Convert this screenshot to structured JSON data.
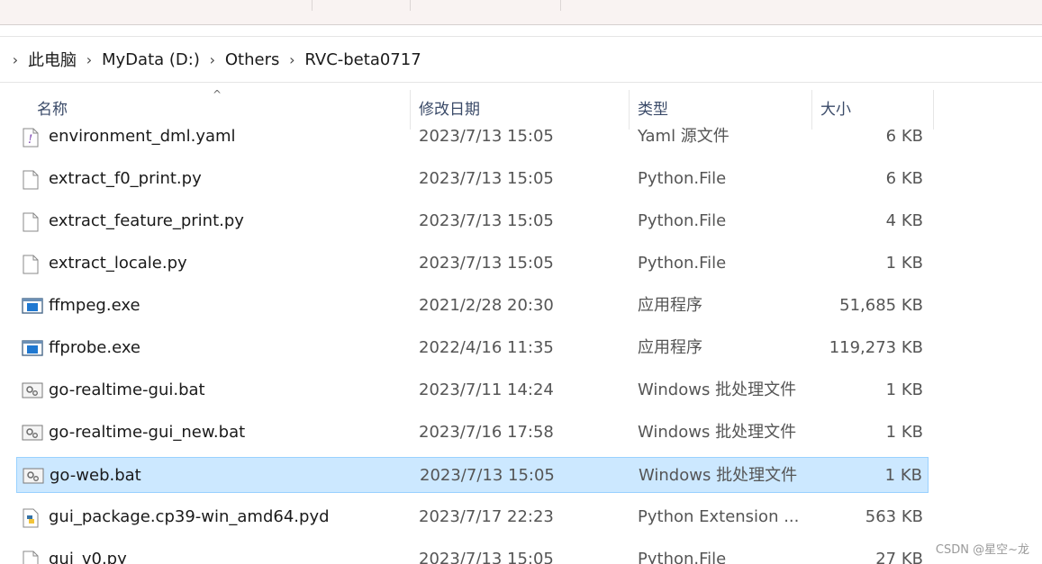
{
  "breadcrumb": [
    "此电脑",
    "MyData (D:)",
    "Others",
    "RVC-beta0717"
  ],
  "columns": {
    "name": "名称",
    "date": "修改日期",
    "type": "类型",
    "size": "大小"
  },
  "files": [
    {
      "name": "environment_dml.yaml",
      "date": "2023/7/13 15:05",
      "type": "Yaml 源文件",
      "size": "6 KB",
      "icon": "yaml-file-icon"
    },
    {
      "name": "extract_f0_print.py",
      "date": "2023/7/13 15:05",
      "type": "Python.File",
      "size": "6 KB",
      "icon": "blank-file-icon"
    },
    {
      "name": "extract_feature_print.py",
      "date": "2023/7/13 15:05",
      "type": "Python.File",
      "size": "4 KB",
      "icon": "blank-file-icon"
    },
    {
      "name": "extract_locale.py",
      "date": "2023/7/13 15:05",
      "type": "Python.File",
      "size": "1 KB",
      "icon": "blank-file-icon"
    },
    {
      "name": "ffmpeg.exe",
      "date": "2021/2/28 20:30",
      "type": "应用程序",
      "size": "51,685 KB",
      "icon": "exe-icon"
    },
    {
      "name": "ffprobe.exe",
      "date": "2022/4/16 11:35",
      "type": "应用程序",
      "size": "119,273 KB",
      "icon": "exe-icon"
    },
    {
      "name": "go-realtime-gui.bat",
      "date": "2023/7/11 14:24",
      "type": "Windows 批处理文件",
      "size": "1 KB",
      "icon": "batch-file-icon"
    },
    {
      "name": "go-realtime-gui_new.bat",
      "date": "2023/7/16 17:58",
      "type": "Windows 批处理文件",
      "size": "1 KB",
      "icon": "batch-file-icon"
    },
    {
      "name": "go-web.bat",
      "date": "2023/7/13 15:05",
      "type": "Windows 批处理文件",
      "size": "1 KB",
      "icon": "batch-file-icon",
      "selected": true
    },
    {
      "name": "gui_package.cp39-win_amd64.pyd",
      "date": "2023/7/17 22:23",
      "type": "Python Extension ...",
      "size": "563 KB",
      "icon": "python-extension-icon"
    },
    {
      "name": "gui_v0.py",
      "date": "2023/7/13 15:05",
      "type": "Python.File",
      "size": "27 KB",
      "icon": "blank-file-icon"
    }
  ],
  "watermark": "CSDN @星空~龙",
  "colors": {
    "selection": "#cce8ff",
    "selection_border": "#99d1ff",
    "header_text": "#3a4a68"
  }
}
